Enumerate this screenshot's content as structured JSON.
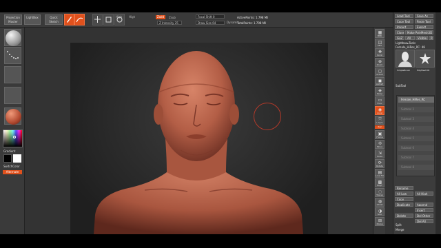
{
  "top_shelf": {
    "projection_master": "Projection Master",
    "lightbox": "LightBox",
    "quick_sketch": "Quick Sketch",
    "tools": [
      {
        "icon": "edit-icon",
        "label": "Edit",
        "active": true
      },
      {
        "icon": "draw-icon",
        "label": "Draw",
        "active": true
      },
      {
        "icon": "move-icon",
        "label": "Move",
        "active": false
      },
      {
        "icon": "scale-icon",
        "label": "Scale",
        "active": false
      },
      {
        "icon": "rotate-icon",
        "label": "Rotate",
        "active": false
      }
    ],
    "high_label": "High",
    "high2_label": "High",
    "zadd": "Zadd",
    "zsub": "Zsub",
    "rgb_intensity": "Z Intensity 25",
    "focal_shift": "Focal Shift 0",
    "draw_size": "Draw Size 64",
    "dynamic": "Dynamic",
    "active_points": "ActivePoints: 1.798 Mil",
    "total_points": "TotalPoints: 1.798 Mil"
  },
  "left_shelf": {
    "gradient": "Gradient",
    "switch_color": "SwitchColor",
    "alternate": "Alternate"
  },
  "right_shelf": {
    "buttons": [
      {
        "name": "bpr-button",
        "glyph": "▦",
        "label": "BPR"
      },
      {
        "name": "spix-button",
        "glyph": "◫",
        "label": "SPix"
      },
      {
        "name": "scroll-button",
        "glyph": "✥",
        "label": "Scroll"
      },
      {
        "name": "zoom-button",
        "glyph": "⊕",
        "label": "Zoom"
      },
      {
        "name": "actual-button",
        "glyph": "◻",
        "label": "Actual"
      },
      {
        "name": "aahalf-button",
        "glyph": "◼",
        "label": "AAHalf"
      },
      {
        "name": "persp-button",
        "glyph": "◈",
        "label": "Persp"
      },
      {
        "name": "floor-button",
        "glyph": "▭",
        "label": "Floor"
      },
      {
        "name": "local-button",
        "glyph": "◉",
        "label": "Local"
      },
      {
        "name": "xyz-button",
        "glyph": "⤧",
        "label": "L.Sym"
      },
      {
        "name": "frame-button",
        "glyph": "▣",
        "label": "Frame"
      },
      {
        "name": "move-view-button",
        "glyph": "✣",
        "label": "Move"
      },
      {
        "name": "scale-view-button",
        "glyph": "⇲",
        "label": "Scale"
      },
      {
        "name": "rotate-view-button",
        "glyph": "⟳",
        "label": "Rotate"
      },
      {
        "name": "linefill-button",
        "glyph": "▤",
        "label": "Line Fill"
      },
      {
        "name": "polyf-button",
        "glyph": "▩",
        "label": "PolyF"
      },
      {
        "name": "transp-button",
        "glyph": "◌",
        "label": "Transp"
      },
      {
        "name": "ghost-button",
        "glyph": "◍",
        "label": "Ghost"
      },
      {
        "name": "solo-button",
        "glyph": "◑",
        "label": "Solo"
      },
      {
        "name": "xpose-button",
        "glyph": "⊞",
        "label": "Xpose"
      }
    ],
    "orange_small": "Xyz"
  },
  "tool_palette": {
    "load_tool": "Load Tool",
    "save_as": "Save As",
    "copy_tool": "Copy Tool",
    "paste_tool": "Paste Tool",
    "import": "Import",
    "export": "Export",
    "clone": "Clone",
    "make_polymesh": "Make PolyMesh3D",
    "goz": "GoZ",
    "all": "All",
    "visible": "Visible",
    "r": "R",
    "lightbox_tools": "Lightbox▸Tools",
    "current_tool": "Female_HiRes_RC: 48",
    "simple_brush": "SimpleBrush",
    "polymesh": "PolyMesh3D",
    "subtool_title": "SubTool",
    "subtools": [
      {
        "label": "Female_HiRes_RC",
        "selected": true
      },
      {
        "label": "Subtool 2",
        "selected": false
      },
      {
        "label": "Subtool 3",
        "selected": false
      },
      {
        "label": "Subtool 4",
        "selected": false
      },
      {
        "label": "Subtool 5",
        "selected": false
      },
      {
        "label": "Subtool 6",
        "selected": false
      },
      {
        "label": "Subtool 7",
        "selected": false
      },
      {
        "label": "Subtool 8",
        "selected": false
      }
    ],
    "rename": "Rename",
    "all_low": "All Low",
    "all_high": "All High",
    "copy": "Copy",
    "duplicate": "Duplicate",
    "append": "Append",
    "insert": "Insert",
    "delete": "Delete",
    "del_other": "Del Other",
    "del_all": "Del All",
    "split": "Split",
    "merge": "Merge"
  }
}
